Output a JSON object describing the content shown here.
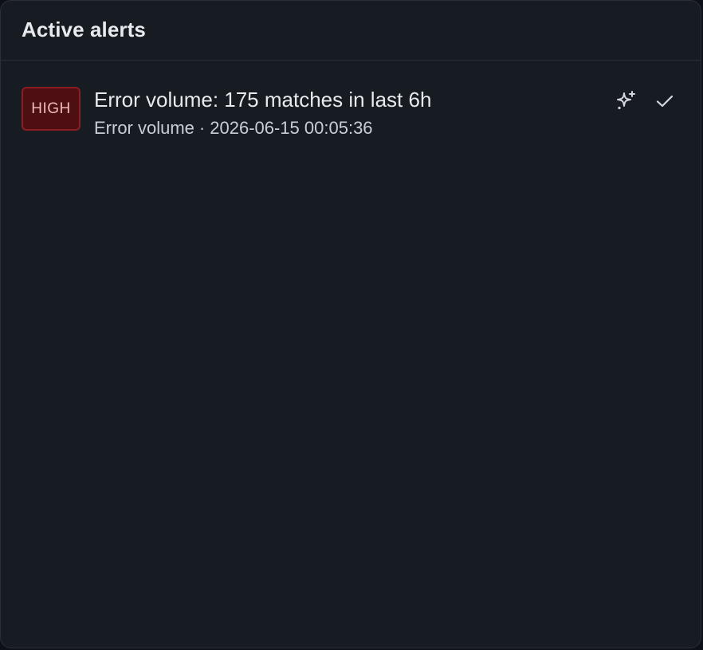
{
  "panel": {
    "title": "Active alerts"
  },
  "alerts": [
    {
      "severity": "HIGH",
      "title": "Error volume: 175 matches in last 6h",
      "rule": "Error volume",
      "separator": "·",
      "timestamp": "2026-06-15 00:05:36",
      "actions": [
        {
          "icon": "sparkles-icon"
        },
        {
          "icon": "check-icon"
        }
      ]
    }
  ],
  "colors": {
    "panel_bg": "#171b22",
    "border": "#2a2f38",
    "severity_high_bg": "#4e0f12",
    "severity_high_border": "#8a1e22",
    "severity_high_text": "#f2b9b9",
    "text_primary": "#e8eaee",
    "text_secondary": "#c9ced6"
  }
}
